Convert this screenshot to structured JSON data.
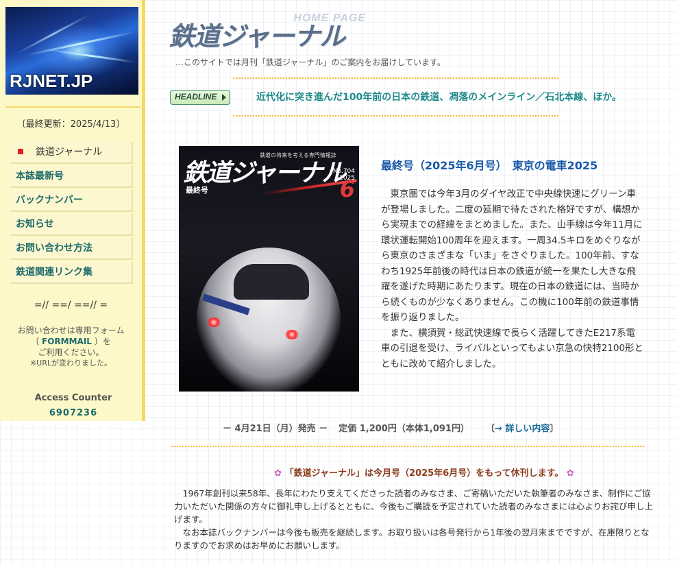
{
  "sidebar": {
    "logo_text": "RJNET.JP",
    "last_updated": "〔最終更新：2025/4/13〕",
    "nav": [
      {
        "label": "鉄道ジャーナル",
        "current": true
      },
      {
        "label": "本誌最新号"
      },
      {
        "label": "バックナンバー"
      },
      {
        "label": "お知らせ"
      },
      {
        "label": "お問い合わせ方法"
      },
      {
        "label": "鉄道関連リンク集"
      }
    ],
    "separator": "=// ==/ ==// =",
    "contact_line1": "お問い合わせは専用フォーム",
    "contact_bracket_open": "〔 ",
    "contact_formmail": "FORMMAIL",
    "contact_bracket_close": " 〕を",
    "contact_line3": "ご利用ください。",
    "contact_note": "※URLが変わりました。",
    "counter_label": "Access Counter",
    "counter_value": "6907236"
  },
  "header": {
    "title_jp": "鉄道ジャーナル",
    "title_en": "HOME PAGE",
    "description": "…このサイトでは月刊「鉄道ジャーナル」のご案内をお届けしています。"
  },
  "headline": {
    "badge": "HEADLINE",
    "text": "近代化に突き進んだ100年前の日本の鉄道、凋落のメインライン／石北本線、ほか。"
  },
  "cover": {
    "tag": "鉄道の将来を考える専門情報誌",
    "title": "鉄道ジャーナル",
    "label": "最終号",
    "issue_no": "No.704",
    "year": "2025",
    "month": "6"
  },
  "article": {
    "title": "最終号（2025年6月号）　東京の電車2025",
    "paragraphs": [
      "東京圏では今年3月のダイヤ改正で中央線快速にグリーン車が登場しました。二度の延期で待たされた格好ですが、構想から実現までの経緯をまとめました。また、山手線は今年11月に環状運転開始100周年を迎えます。一周34.5キロをめぐりながら東京のさまざまな「いま」をさぐりました。100年前、すなわち1925年前後の時代は日本の鉄道が統一を果たし大きな飛躍を遂げた時期にあたります。現在の日本の鉄道には、当時から続くものが少なくありません。この機に100年前の鉄道事情を振り返りました。",
      "また、横須賀・総武快速線で長らく活躍してきたE217系電車の引退を受け、ライバルといってもよい京急の快特2100形とともに改めて紹介しました。"
    ]
  },
  "release": {
    "date": "－ 4月21日（月）発売 －",
    "price": "定価 1,200円（本体1,091円）",
    "link_open": "〔",
    "link_text": "→ 詳しい内容",
    "link_close": "〕"
  },
  "notice": {
    "flower": "✿",
    "title": "「鉄道ジャーナル」は今月号（2025年6月号）をもって休刊します。",
    "paragraphs": [
      "1967年創刊以来58年、長年にわたり支えてくださった読者のみなさま、ご寄稿いただいた執筆者のみなさま、制作にご協力いただいた関係の方々に御礼申し上げるとともに、今後もご購読を予定されていた読者のみなさまには心よりお詫び申し上げます。",
      "なお本誌バックナンバーは今後も販売を継続します。お取り扱いは各号発行から1年後の翌月末までですが、在庫限りとなりますのでお求めはお早めにお願いします。"
    ]
  }
}
